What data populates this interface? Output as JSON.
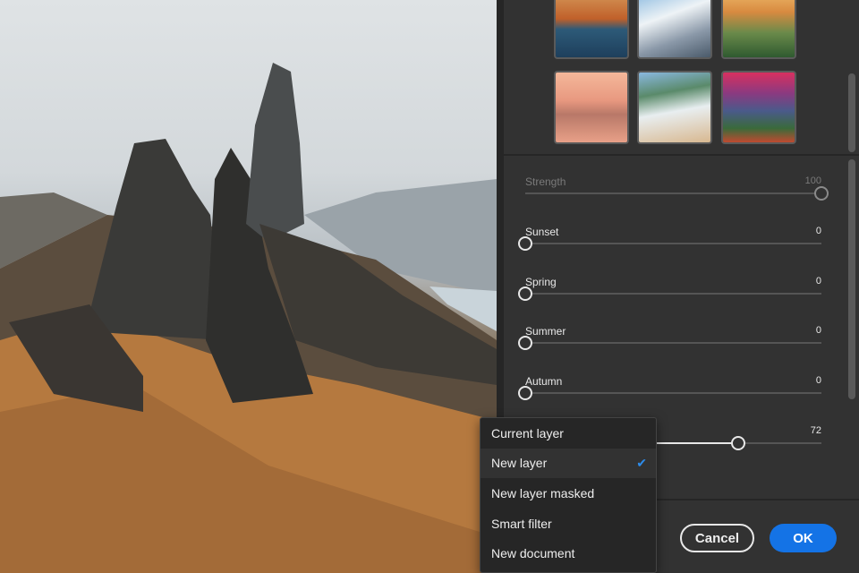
{
  "thumbnails": [
    {
      "name": "autumn-lake"
    },
    {
      "name": "snowy-mountain"
    },
    {
      "name": "valley-sunrise"
    },
    {
      "name": "pink-misty-lake"
    },
    {
      "name": "beach-coast"
    },
    {
      "name": "purple-sunset-ridge"
    }
  ],
  "sliders": [
    {
      "label": "Strength",
      "value": "100",
      "fraction": 1.0,
      "disabled": true
    },
    {
      "label": "Sunset",
      "value": "0",
      "fraction": 0
    },
    {
      "label": "Spring",
      "value": "0",
      "fraction": 0
    },
    {
      "label": "Summer",
      "value": "0",
      "fraction": 0
    },
    {
      "label": "Autumn",
      "value": "0",
      "fraction": 0
    },
    {
      "label": "",
      "value": "72",
      "fraction": 0.72
    }
  ],
  "output_menu": {
    "items": [
      "Current layer",
      "New layer",
      "New layer masked",
      "Smart filter",
      "New document"
    ],
    "selected": "New layer"
  },
  "buttons": {
    "cancel": "Cancel",
    "ok": "OK"
  },
  "colors": {
    "accent": "#1473e6",
    "check": "#2d8ceb"
  }
}
